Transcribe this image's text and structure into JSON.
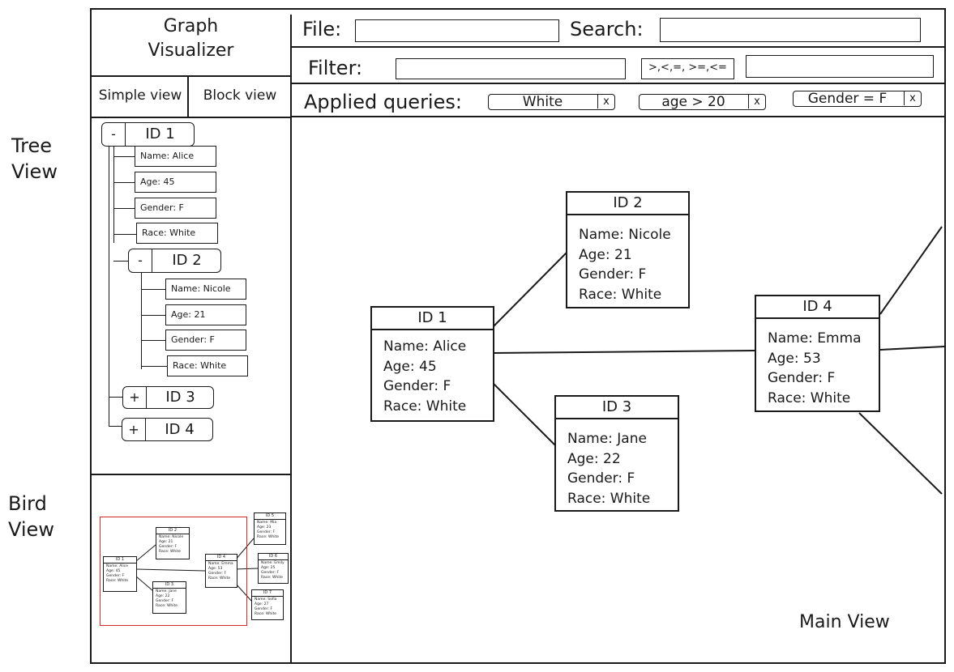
{
  "side_labels": {
    "tree_view": [
      "Tree",
      "View"
    ],
    "bird_view": [
      "Bird",
      "View"
    ]
  },
  "app": {
    "title_line1": "Graph",
    "title_line2": "Visualizer"
  },
  "tabs": {
    "simple": "Simple view",
    "block": "Block view"
  },
  "toolbar": {
    "file_label": "File:",
    "file_value": "",
    "search_label": "Search:",
    "search_value": "",
    "filter_label": "Filter:",
    "filter_value": "",
    "operators": ">,<,=, >=,<=",
    "operator_value": ""
  },
  "queries": {
    "label": "Applied queries:",
    "chips": [
      {
        "text": "White",
        "remove": "x"
      },
      {
        "text": "age > 20",
        "remove": "x"
      },
      {
        "text": "Gender = F",
        "remove": "x"
      }
    ]
  },
  "tree": {
    "node1": {
      "toggle": "-",
      "id": "ID 1",
      "fields": [
        "Name: Alice",
        "Age: 45",
        "Gender: F",
        "Race: White"
      ]
    },
    "node2": {
      "toggle": "-",
      "id": "ID 2",
      "fields": [
        "Name: Nicole",
        "Age: 21",
        "Gender: F",
        "Race: White"
      ]
    },
    "node3": {
      "toggle": "+",
      "id": "ID 3"
    },
    "node4": {
      "toggle": "+",
      "id": "ID 4"
    }
  },
  "graph": {
    "nodes": [
      {
        "id": "ID 1",
        "lines": [
          "Name: Alice",
          "Age: 45",
          "Gender: F",
          "Race: White"
        ]
      },
      {
        "id": "ID 2",
        "lines": [
          "Name: Nicole",
          "Age: 21",
          "Gender: F",
          "Race: White"
        ]
      },
      {
        "id": "ID 3",
        "lines": [
          "Name: Jane",
          "Age: 22",
          "Gender: F",
          "Race: White"
        ]
      },
      {
        "id": "ID 4",
        "lines": [
          "Name: Emma",
          "Age: 53",
          "Gender: F",
          "Race: White"
        ]
      }
    ]
  },
  "minimap": {
    "nodes": [
      {
        "id": "ID 1",
        "lines": [
          "Name: Alice",
          "Age: 45",
          "Gender: F",
          "Race: White"
        ]
      },
      {
        "id": "ID 2",
        "lines": [
          "Name: Nicole",
          "Age: 21",
          "Gender: F",
          "Race: White"
        ]
      },
      {
        "id": "ID 3",
        "lines": [
          "Name: Jane",
          "Age: 22",
          "Gender: F",
          "Race: White"
        ]
      },
      {
        "id": "ID 4",
        "lines": [
          "Name: Emma",
          "Age: 53",
          "Gender: F",
          "Race: White"
        ]
      },
      {
        "id": "ID 5",
        "lines": [
          "Name: Mia",
          "Age: 23",
          "Gender: F",
          "Race: White"
        ]
      },
      {
        "id": "ID 6",
        "lines": [
          "Name: Emily",
          "Age: 25",
          "Gender: F",
          "Race: White"
        ]
      },
      {
        "id": "ID 7",
        "lines": [
          "Name: Sofia",
          "Age: 27",
          "Gender: F",
          "Race: White"
        ]
      }
    ],
    "viewport_color": "#d62828"
  },
  "main_view_label": "Main View"
}
